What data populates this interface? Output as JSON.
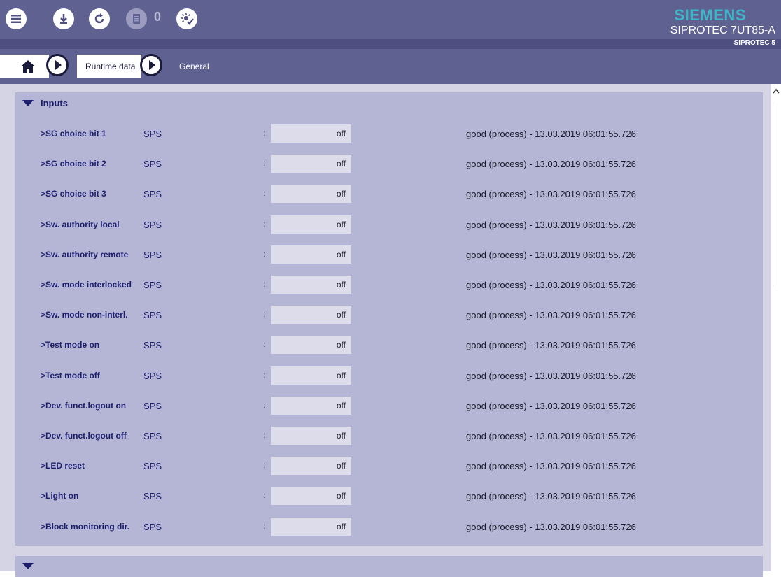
{
  "toolbar": {
    "menu_icon": "menu-icon",
    "download_icon": "download-icon",
    "refresh_icon": "refresh-icon",
    "log_icon": "log-icon",
    "log_count": "0",
    "led_icon": "led-test-icon"
  },
  "brand": {
    "logo": "SIEMENS",
    "device": "SIPROTEC 7UT85-A",
    "family": "SIPROTEC 5"
  },
  "breadcrumb": {
    "home_icon": "home-icon",
    "item1": "Runtime data",
    "item2": "General"
  },
  "section": {
    "title": "Inputs"
  },
  "rows": [
    {
      "name": ">SG choice bit 1",
      "type": "SPS",
      "value": "off",
      "quality": "good (process) - 13.03.2019 06:01:55.726"
    },
    {
      "name": ">SG choice bit 2",
      "type": "SPS",
      "value": "off",
      "quality": "good (process) - 13.03.2019 06:01:55.726"
    },
    {
      "name": ">SG choice bit 3",
      "type": "SPS",
      "value": "off",
      "quality": "good (process) - 13.03.2019 06:01:55.726"
    },
    {
      "name": ">Sw. authority local",
      "type": "SPS",
      "value": "off",
      "quality": "good (process) - 13.03.2019 06:01:55.726"
    },
    {
      "name": ">Sw. authority remote",
      "type": "SPS",
      "value": "off",
      "quality": "good (process) - 13.03.2019 06:01:55.726"
    },
    {
      "name": ">Sw. mode interlocked",
      "type": "SPS",
      "value": "off",
      "quality": "good (process) - 13.03.2019 06:01:55.726"
    },
    {
      "name": ">Sw. mode non-interl.",
      "type": "SPS",
      "value": "off",
      "quality": "good (process) - 13.03.2019 06:01:55.726"
    },
    {
      "name": ">Test mode on",
      "type": "SPS",
      "value": "off",
      "quality": "good (process) - 13.03.2019 06:01:55.726"
    },
    {
      "name": ">Test mode off",
      "type": "SPS",
      "value": "off",
      "quality": "good (process) - 13.03.2019 06:01:55.726"
    },
    {
      "name": ">Dev. funct.logout on",
      "type": "SPS",
      "value": "off",
      "quality": "good (process) - 13.03.2019 06:01:55.726"
    },
    {
      "name": ">Dev. funct.logout off",
      "type": "SPS",
      "value": "off",
      "quality": "good (process) - 13.03.2019 06:01:55.726"
    },
    {
      "name": ">LED reset",
      "type": "SPS",
      "value": "off",
      "quality": "good (process) - 13.03.2019 06:01:55.726"
    },
    {
      "name": ">Light on",
      "type": "SPS",
      "value": "off",
      "quality": "good (process) - 13.03.2019 06:01:55.726"
    },
    {
      "name": ">Block monitoring dir.",
      "type": "SPS",
      "value": "off",
      "quality": "good (process) - 13.03.2019 06:01:55.726"
    }
  ],
  "colon": ":"
}
